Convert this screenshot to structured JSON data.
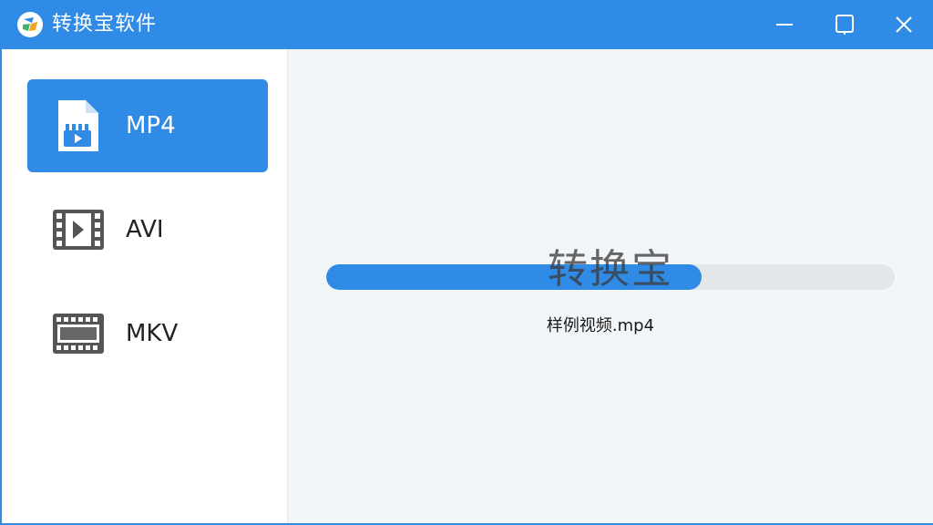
{
  "window": {
    "title": "转换宝软件",
    "accent_color": "#2f8be6",
    "controls": [
      "minimize-icon",
      "maximize-icon",
      "close-icon"
    ]
  },
  "sidebar": {
    "items": [
      {
        "label": "MP4",
        "icon": "mp4-file-icon",
        "active": true
      },
      {
        "label": "AVI",
        "icon": "play-film-icon",
        "active": false
      },
      {
        "label": "MKV",
        "icon": "film-strip-icon",
        "active": false
      }
    ]
  },
  "main": {
    "watermark": "转换宝",
    "progress_fraction": 0.66,
    "filename": "样例视频.mp4"
  }
}
